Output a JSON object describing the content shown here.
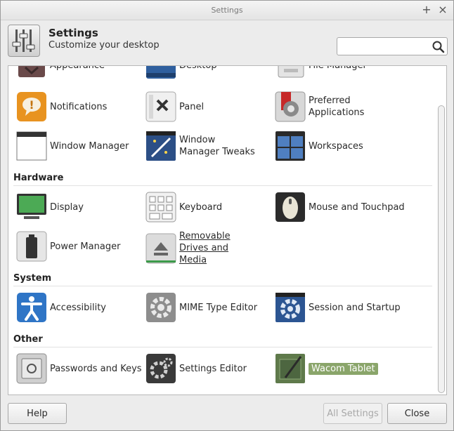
{
  "window": {
    "title": "Settings"
  },
  "header": {
    "title": "Settings",
    "subtitle": "Customize your desktop",
    "search_placeholder": ""
  },
  "categories": {
    "hardware": "Hardware",
    "system": "System",
    "other": "Other"
  },
  "items": {
    "appearance": "Appearance",
    "desktop": "Desktop",
    "file_manager": "File Manager",
    "notifications": "Notifications",
    "panel": "Panel",
    "preferred_apps": "Preferred Applications",
    "window_manager": "Window Manager",
    "wm_tweaks": "Window Manager Tweaks",
    "workspaces": "Workspaces",
    "display": "Display",
    "keyboard": "Keyboard",
    "mouse": "Mouse and Touchpad",
    "power": "Power Manager",
    "removable": "Removable Drives and Media",
    "accessibility": "Accessibility",
    "mime": "MIME Type Editor",
    "session": "Session and Startup",
    "passwords": "Passwords and Keys",
    "settings_editor": "Settings Editor",
    "wacom": "Wacom Tablet"
  },
  "footer": {
    "help": "Help",
    "all_settings": "All Settings",
    "close": "Close"
  },
  "colors": {
    "selection": "#8aa56a"
  }
}
